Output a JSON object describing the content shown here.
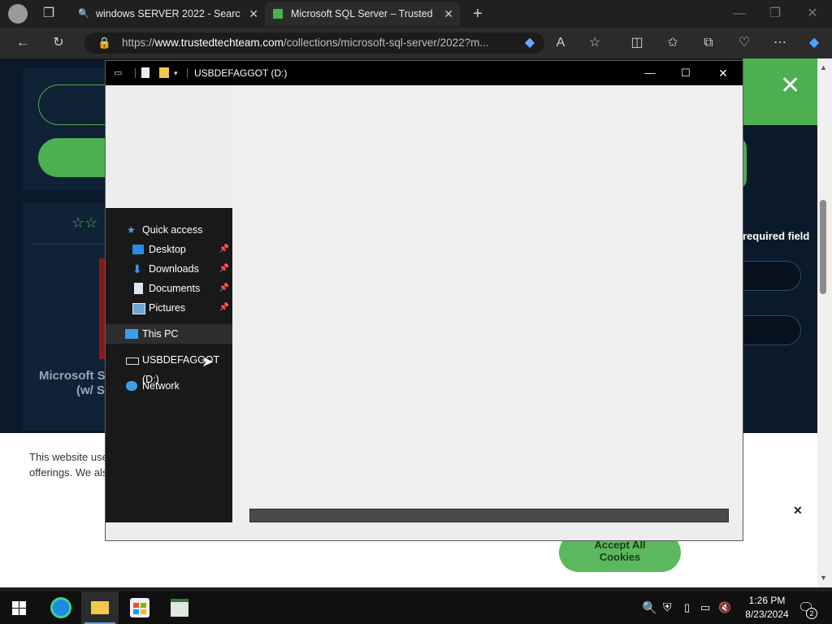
{
  "browser": {
    "tabs": [
      {
        "title": "windows SERVER 2022 - Search"
      },
      {
        "title": "Microsoft SQL Server – Trusted Te"
      }
    ],
    "url_prefix": "https://",
    "url_domain": "www.trustedtechteam.com",
    "url_path": "/collections/microsoft-sql-server/2022?m..."
  },
  "website": {
    "required_field": "required field",
    "product_title_line1": "Microsoft S",
    "product_title_line2": "(w/ S",
    "cookie_text_line1": "This website use",
    "cookie_text_line2": "offerings. We als",
    "accept_button_line1": "Accept All",
    "accept_button_line2": "Cookies"
  },
  "explorer": {
    "title": "USBDEFAGGOT (D:)",
    "nav": [
      {
        "label": "Quick access",
        "icon": "star-icon"
      },
      {
        "label": "Desktop",
        "icon": "desktop-icon",
        "pinned": true
      },
      {
        "label": "Downloads",
        "icon": "download-icon",
        "pinned": true
      },
      {
        "label": "Documents",
        "icon": "documents-icon",
        "pinned": true
      },
      {
        "label": "Pictures",
        "icon": "pictures-icon",
        "pinned": true
      },
      {
        "label": "This PC",
        "icon": "computer-icon"
      },
      {
        "label": "USBDEFAGGOT (D:)",
        "icon": "drive-icon"
      },
      {
        "label": "Network",
        "icon": "network-icon"
      }
    ]
  },
  "taskbar": {
    "time": "1:26 PM",
    "date": "8/23/2024",
    "notification_count": "2"
  },
  "colors": {
    "accent_green": "#5cb85c",
    "site_bg": "#0b1a2a",
    "titlebar": "#000000"
  }
}
